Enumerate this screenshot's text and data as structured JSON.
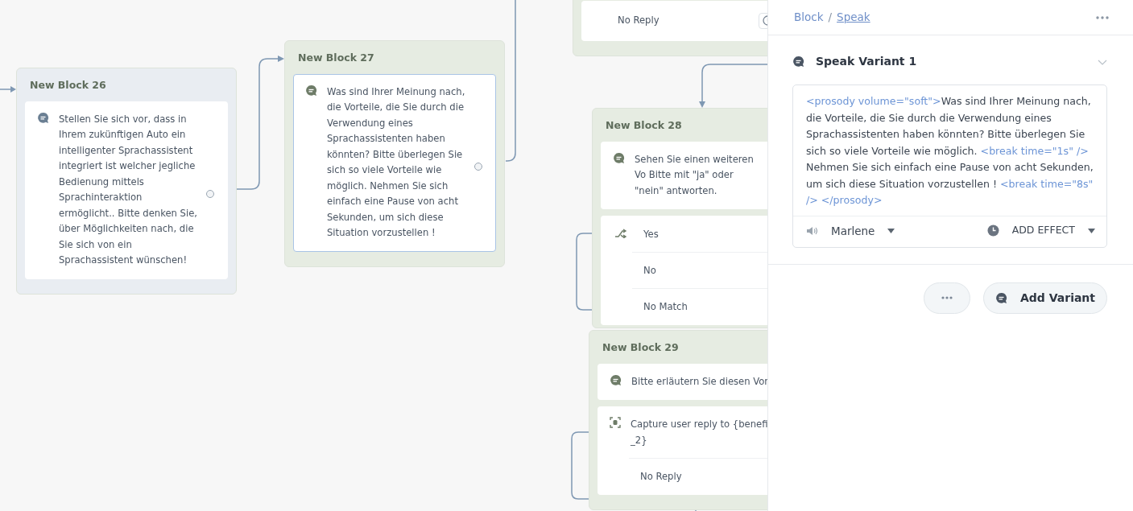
{
  "canvas": {
    "blocks": [
      {
        "title": "New Block 26",
        "color": "#e9edf2",
        "steps": [
          {
            "kind": "speak",
            "selected": false,
            "text": "Stellen Sie sich vor, dass in Ihrem zukünftigen Auto ein intelligenter Sprachassistent integriert ist  welcher jegliche Bedienung mittels Sprachinteraktion ermöglicht..  Bitte denken Sie, über Möglichkeiten nach, die Sie sich von ein Sprachassistent wünschen!"
          }
        ]
      },
      {
        "title": "New Block 27",
        "color": "#e6ece2",
        "steps": [
          {
            "kind": "speak",
            "selected": true,
            "text": "Was sind Ihrer Meinung nach, die Vorteile, die Sie durch die Verwendung eines Sprachassistenten haben könnten? Bitte überlegen Sie sich so viele Vorteile wie möglich.   Nehmen Sie sich einfach eine Pause von acht Sekunden, um sich diese Situation vorzustellen !"
          }
        ]
      },
      {
        "color": "#e6ece2",
        "steps": [
          {
            "kind": "reply",
            "selected": false,
            "text": "No Reply"
          }
        ]
      },
      {
        "title": "New Block 28",
        "color": "#e6ece2",
        "steps": [
          {
            "kind": "speak",
            "selected": false,
            "text": "Sehen Sie einen weiteren Vo Bitte mit \"ja\" oder \"nein\" antworten."
          },
          {
            "kind": "choice",
            "selected": false,
            "options": [
              "Yes",
              "No",
              "No Match"
            ]
          }
        ]
      },
      {
        "title": "New Block 29",
        "color": "#e6ece2",
        "steps": [
          {
            "kind": "speak",
            "selected": false,
            "text": "Bitte erläutern Sie diesen Vor"
          },
          {
            "kind": "capture",
            "selected": false,
            "lines": [
              "Capture user reply to {benefi",
              "_2}"
            ],
            "options": [
              "No Reply"
            ]
          }
        ]
      }
    ]
  },
  "panel": {
    "breadcrumb": [
      "Block",
      "/",
      "Speak"
    ],
    "variant": {
      "title": "Speak Variant 1",
      "expanded": true,
      "segments": [
        {
          "kind": "tag",
          "text": "<prosody volume=\"soft\">"
        },
        {
          "kind": "text",
          "text": "Was sind Ihrer Meinung nach, die Vorteile, die Sie durch die Verwendung eines Sprachassistenten haben könnten? Bitte überlegen Sie sich so viele Vorteile wie möglich. "
        },
        {
          "kind": "tag",
          "text": "<break time=\"1s\" />"
        },
        {
          "kind": "text",
          "text": "  Nehmen Sie sich einfach eine Pause von acht Sekunden, um sich diese Situation vorzustellen ! "
        },
        {
          "kind": "tag",
          "text": "<break time=\"8s\" /> </prosody>"
        }
      ],
      "voice": "Marlene",
      "effect": "ADD EFFECT"
    },
    "add_button": "Add Variant"
  }
}
